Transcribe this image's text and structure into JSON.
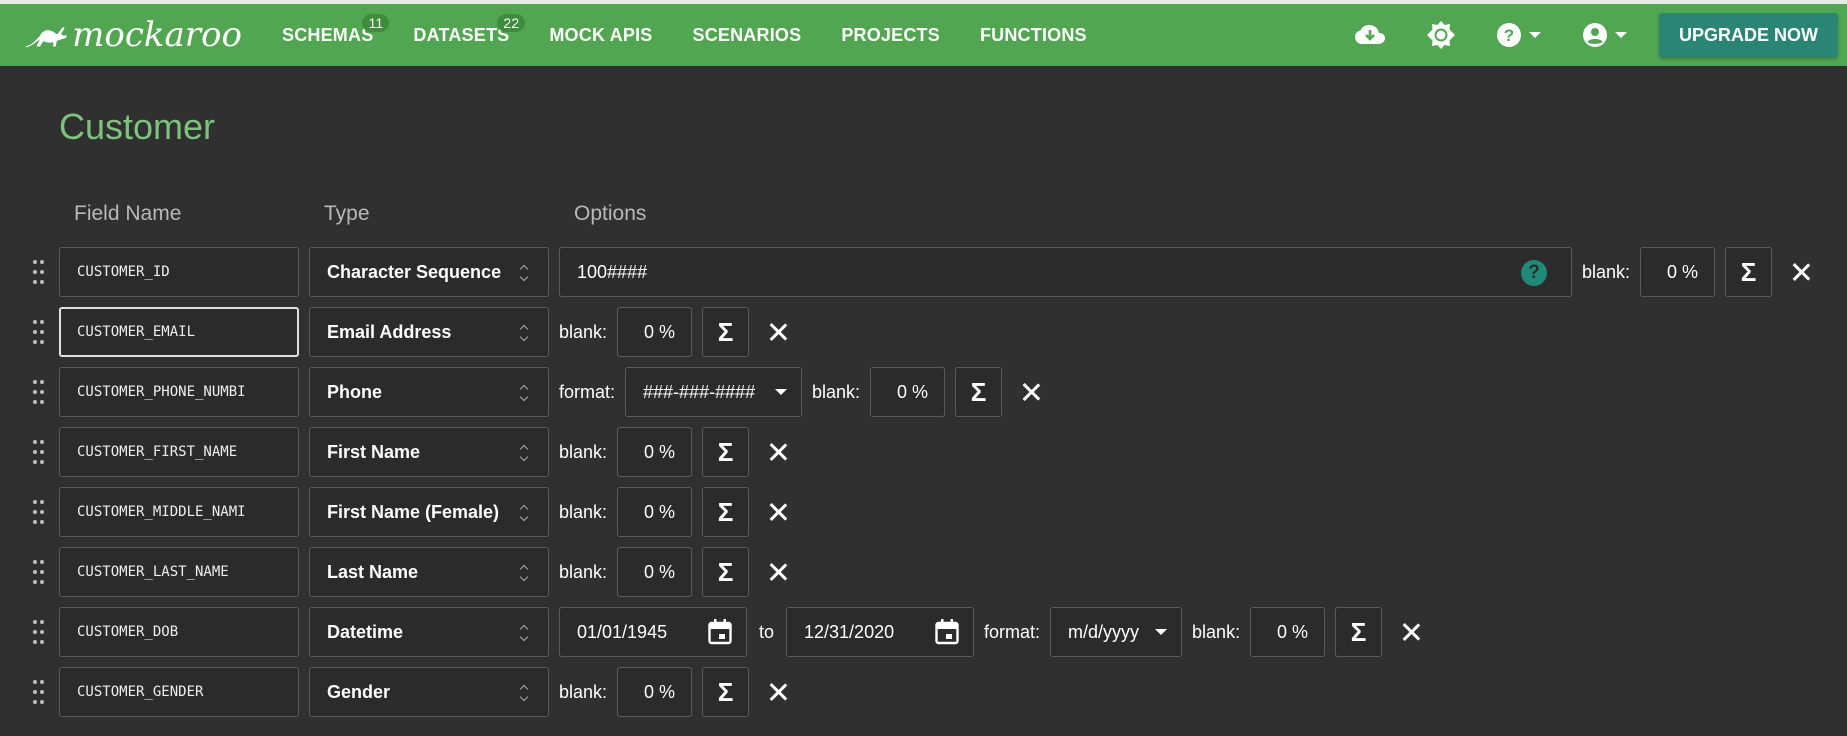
{
  "nav": {
    "brand": "mockaroo",
    "items": [
      {
        "label": "SCHEMAS",
        "badge": "11"
      },
      {
        "label": "DATASETS",
        "badge": "22"
      },
      {
        "label": "MOCK APIS",
        "badge": ""
      },
      {
        "label": "SCENARIOS",
        "badge": ""
      },
      {
        "label": "PROJECTS",
        "badge": ""
      },
      {
        "label": "FUNCTIONS",
        "badge": ""
      }
    ],
    "upgrade_label": "UPGRADE NOW",
    "colors": {
      "bar": "#52a652",
      "upgrade": "#2a8575"
    }
  },
  "page": {
    "title": "Customer",
    "headers": {
      "field": "Field Name",
      "type": "Type",
      "options": "Options"
    }
  },
  "rows": [
    {
      "name": "CUSTOMER_ID",
      "type": "Character Sequence",
      "sequence": "100####",
      "blank_label": "blank:",
      "blank": "0 %"
    },
    {
      "name": "CUSTOMER_EMAIL",
      "type": "Email Address",
      "blank_label": "blank:",
      "blank": "0 %"
    },
    {
      "name": "CUSTOMER_PHONE_NUMBI",
      "type": "Phone",
      "format_label": "format:",
      "format": "###-###-####",
      "blank_label": "blank:",
      "blank": "0 %"
    },
    {
      "name": "CUSTOMER_FIRST_NAME",
      "type": "First Name",
      "blank_label": "blank:",
      "blank": "0 %"
    },
    {
      "name": "CUSTOMER_MIDDLE_NAMI",
      "type": "First Name (Female)",
      "blank_label": "blank:",
      "blank": "0 %"
    },
    {
      "name": "CUSTOMER_LAST_NAME",
      "type": "Last Name",
      "blank_label": "blank:",
      "blank": "0 %"
    },
    {
      "name": "CUSTOMER_DOB",
      "type": "Datetime",
      "from": "01/01/1945",
      "to_label": "to",
      "to": "12/31/2020",
      "format_label": "format:",
      "format": "m/d/yyyy",
      "blank_label": "blank:",
      "blank": "0 %"
    },
    {
      "name": "CUSTOMER_GENDER",
      "type": "Gender",
      "blank_label": "blank:",
      "blank": "0 %"
    }
  ],
  "glyphs": {
    "sigma": "Σ",
    "help": "?"
  }
}
